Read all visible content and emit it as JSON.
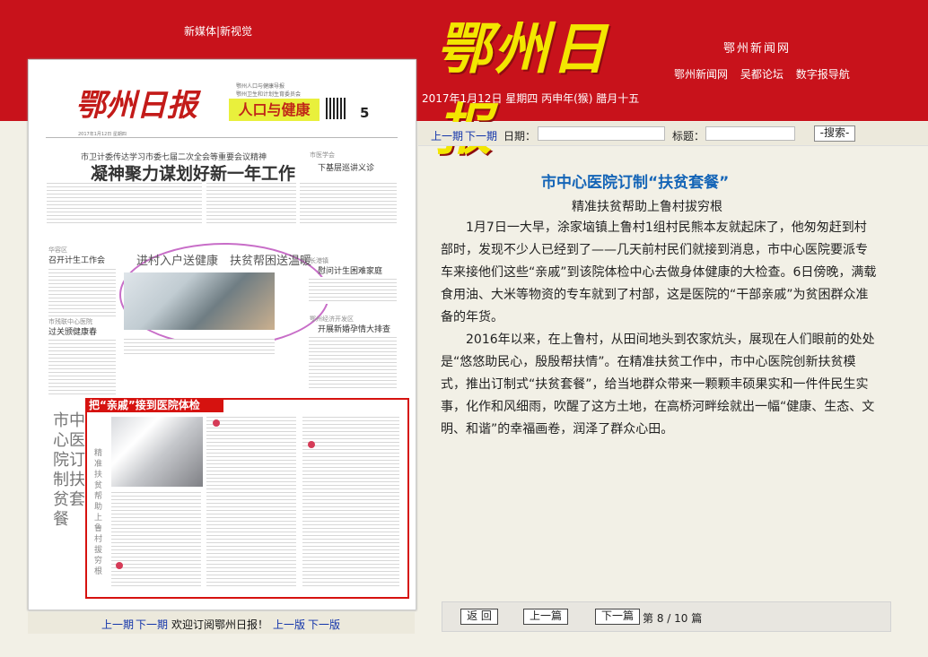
{
  "header": {
    "top_links": "新媒体|新视觉",
    "logo": "鄂州日报",
    "network": "鄂州新闻网",
    "site_links": [
      "鄂州新闻网",
      "吴都论坛",
      "数字报导航"
    ],
    "date": "2017年1月12日 星期四 丙申年(猴) 腊月十五"
  },
  "toolbar": {
    "prev_issue": "上一期",
    "next_issue": "下一期",
    "date_label": "日期：",
    "title_label": "标题：",
    "search": "-搜索-"
  },
  "paper": {
    "logo": "鄂州日报",
    "subtitle_lines": [
      "鄂州人口与健康导报",
      "鄂州卫生和计划生育委员会"
    ],
    "band": "人口与健康",
    "page": "5",
    "info": "2017年1月12日 星期四",
    "top_headline_small": "市卫计委传达学习市委七届二次全会等重要会议精神",
    "top_headline": "凝神聚力谋划好新一年工作",
    "side_items": [
      {
        "tag": "市医学会",
        "title": "下基层巡讲义诊"
      },
      {
        "tag": "华容区",
        "title": "召开计生工作会"
      },
      {
        "tag": "市残联中心医院",
        "title": "过关颁健康春"
      },
      {
        "tag": "长港镇",
        "title": "慰问计生困难家庭"
      },
      {
        "tag": "鄂州经济开发区",
        "title": "开展新婚孕情大排查"
      }
    ],
    "bubble_title": "进村入户送健康　扶贫帮困送温暖",
    "highlight_title": "把“亲戚”接到医院体检",
    "vertical_title": "市中心医院订制扶贫套餐",
    "vertical_subtitle": "精准扶贫帮助上鲁村拔穷根"
  },
  "paper_nav": {
    "prev_issue": "上一期",
    "next_issue": "下一期",
    "welcome": "欢迎订阅鄂州日报！",
    "prev_page": "上一版",
    "next_page": "下一版"
  },
  "article": {
    "title": "市中心医院订制“扶贫套餐”",
    "subtitle": "精准扶贫帮助上鲁村拔穷根",
    "paragraphs": [
      "1月7日一大早，涂家垴镇上鲁村1组村民熊本友就起床了，他匆匆赶到村部时，发现不少人已经到了——几天前村民们就接到消息，市中心医院要派专车来接他们这些“亲戚”到该院体检中心去做身体健康的大检查。6日傍晚，满载食用油、大米等物资的专车就到了村部，这是医院的“干部亲戚”为贫困群众准备的年货。",
      "2016年以来，在上鲁村，从田间地头到农家炕头，展现在人们眼前的处处是“悠悠助民心，殷殷帮扶情”。在精准扶贫工作中，市中心医院创新扶贫模式，推出订制式“扶贫套餐”，给当地群众带来一颗颗丰硕果实和一件件民生实事，化作和风细雨，吹醒了这方土地，在高桥河畔绘就出一幅“健康、生态、文明、和谐”的幸福画卷，润泽了群众心田。"
    ]
  },
  "bottom": {
    "back": "返 回",
    "prev": "上一篇",
    "next": "下一篇",
    "page_info": "第 8 / 10 篇"
  },
  "colors": {
    "header_red": "#c8121b",
    "logo_yellow": "#f3e600",
    "link_blue": "#1133aa",
    "title_blue": "#1565b7",
    "highlight_red": "#d6120f"
  }
}
